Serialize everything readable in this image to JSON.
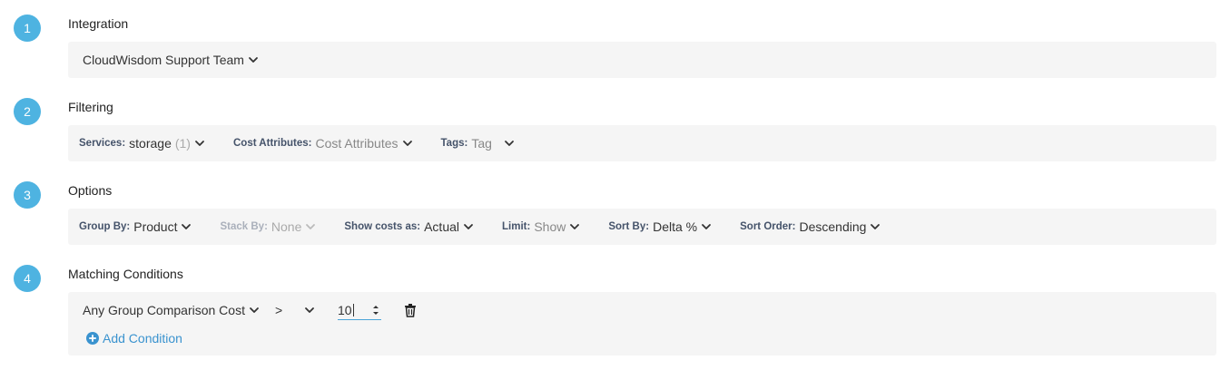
{
  "steps": [
    {
      "number": "1",
      "title": "Integration"
    },
    {
      "number": "2",
      "title": "Filtering"
    },
    {
      "number": "3",
      "title": "Options"
    },
    {
      "number": "4",
      "title": "Matching Conditions"
    }
  ],
  "integration": {
    "value": "CloudWisdom Support Team"
  },
  "filtering": {
    "services": {
      "label": "Services:",
      "value": "storage",
      "count": "(1)"
    },
    "cost_attributes": {
      "label": "Cost Attributes:",
      "value": "Cost Attributes"
    },
    "tags": {
      "label": "Tags:",
      "value": "Tag"
    }
  },
  "options": {
    "group_by": {
      "label": "Group By:",
      "value": "Product"
    },
    "stack_by": {
      "label": "Stack By:",
      "value": "None"
    },
    "show_costs_as": {
      "label": "Show costs as:",
      "value": "Actual"
    },
    "limit": {
      "label": "Limit:",
      "value": "Show"
    },
    "sort_by": {
      "label": "Sort By:",
      "value": "Delta %"
    },
    "sort_order": {
      "label": "Sort Order:",
      "value": "Descending"
    }
  },
  "conditions": {
    "metric": "Any Group Comparison Cost",
    "operator": ">",
    "value": "10",
    "add_label": "Add Condition"
  },
  "colors": {
    "accent": "#4eb3e1",
    "link": "#3a93cf",
    "panel": "#f5f5f5"
  },
  "icons": [
    "chevron-down-icon",
    "trash-icon",
    "plus-circle-icon",
    "spinner-arrows-icon"
  ]
}
